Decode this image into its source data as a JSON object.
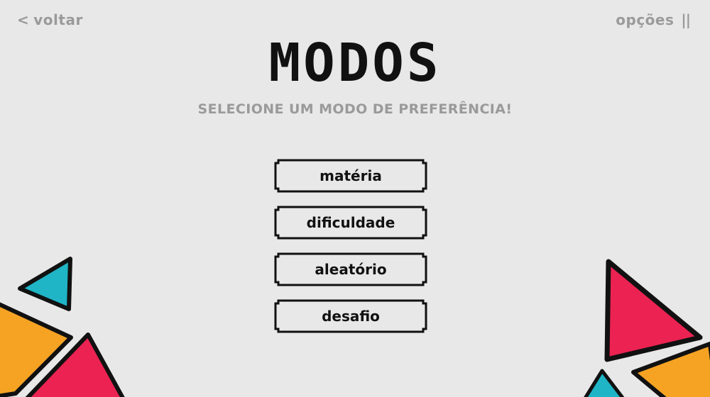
{
  "nav": {
    "back_icon": "chevron-left-icon",
    "back_label": "voltar",
    "options_label": "opções",
    "options_icon": "pause-icon"
  },
  "header": {
    "title": "MODOS",
    "subtitle": "SELECIONE UM MODO DE PREFERÊNCIA!"
  },
  "modes": [
    {
      "label": "matéria"
    },
    {
      "label": "dificuldade"
    },
    {
      "label": "aleatório"
    },
    {
      "label": "desafio"
    }
  ],
  "colors": {
    "background": "#e8e8e8",
    "text": "#111111",
    "muted": "#9a9a9a",
    "teal": "#1fb5c6",
    "orange": "#f6a323",
    "pink": "#ec2252"
  }
}
